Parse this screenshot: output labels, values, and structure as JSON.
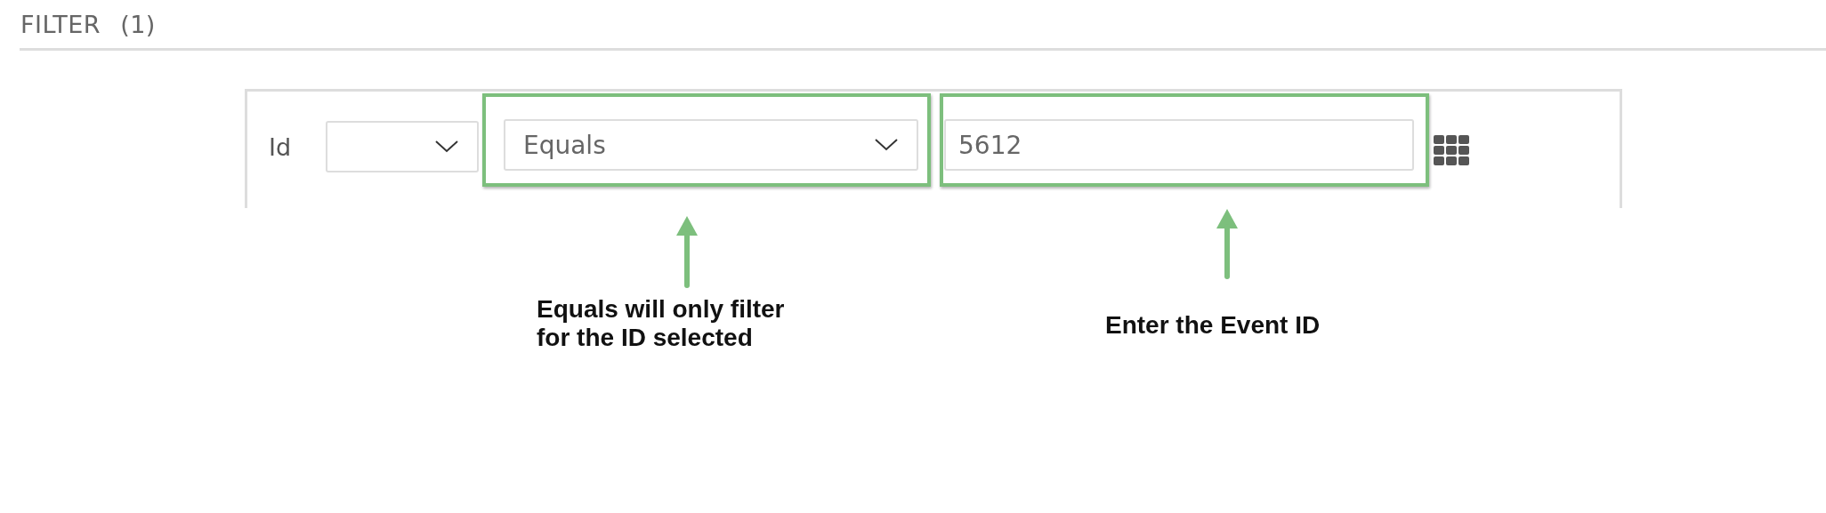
{
  "header": {
    "title": "FILTER",
    "count": "(1)"
  },
  "filter_row": {
    "label": "Id",
    "operator": {
      "value": "Equals",
      "highlighted": true
    },
    "value_input": {
      "value": "5612",
      "highlighted": true
    }
  },
  "annotations": [
    {
      "text": "Equals will only filter\nfor the ID selected"
    },
    {
      "text": "Enter the Event ID"
    }
  ]
}
